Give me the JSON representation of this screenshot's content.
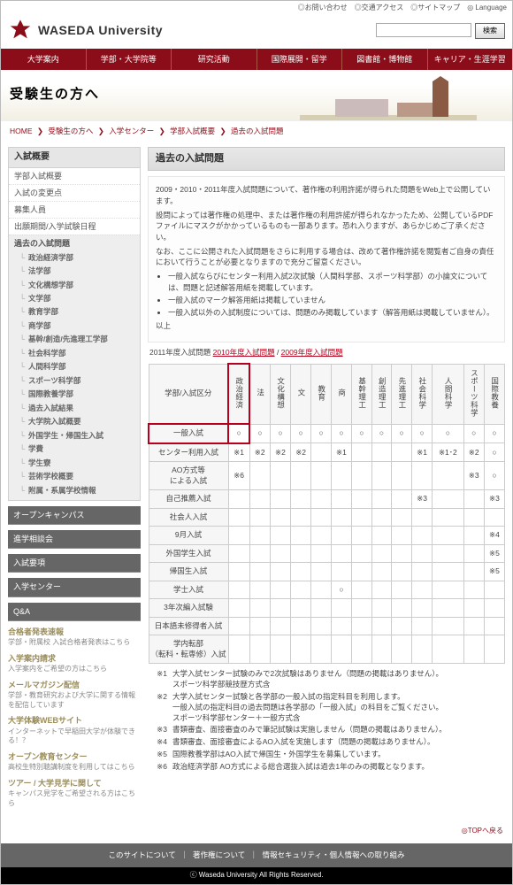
{
  "header": {
    "top_links": [
      "◎お問い合わせ",
      "◎交通アクセス",
      "◎サイトマップ",
      "◎ Language"
    ],
    "site_name": "WASEDA University",
    "search_button": "検索",
    "nav": [
      "大学案内",
      "学部・大学院等",
      "研究活動",
      "国際展開・留学",
      "図書館・博物館",
      "キャリア・生涯学習"
    ],
    "hero_title": "受験生の方へ"
  },
  "breadcrumb": {
    "items": [
      "HOME",
      "受験生の方へ",
      "入学センター",
      "学部入試概要",
      "過去の入試問題"
    ],
    "sep": "❯"
  },
  "side": {
    "title": "入試概要",
    "items": [
      {
        "label": "学部入試概要"
      },
      {
        "label": "入試の変更点"
      },
      {
        "label": "募集人員"
      },
      {
        "label": "出願期間/入学試験日程"
      },
      {
        "label": "過去の入試問題",
        "selected": true,
        "children": [
          "政治経済学部",
          "法学部",
          "文化構想学部",
          "文学部",
          "教育学部",
          "商学部",
          "基幹/創造/先進理工学部",
          "社会科学部",
          "人間科学部",
          "スポーツ科学部",
          "国際教養学部",
          "過去入試結果",
          "大学院入試概要",
          "外国学生・帰国生入試",
          "学費",
          "学生寮",
          "芸術学校概要",
          "附属・系属学校情報"
        ]
      }
    ],
    "dark_items": [
      "オープンキャンパス",
      "進学相談会",
      "入試要項",
      "入学センター",
      "Q&A"
    ],
    "link_items": [
      {
        "title": "合格者発表速報",
        "sub": "学部・附属校 入試合格者発表はこちら"
      },
      {
        "title": "入学案内請求",
        "sub": "入学案内をご希望の方はこちら"
      },
      {
        "title": "メールマガジン配信",
        "sub": "学部・教育研究および大学に関する情報を配信しています"
      },
      {
        "title": "大学体験WEBサイト",
        "sub": "インターネットで早稲田大学が体験できる！？"
      },
      {
        "title": "オープン教育センター",
        "sub": "高校生特別聴講制度を利用してはこちら"
      },
      {
        "title": "ツアー / 大学見学に関して",
        "sub": "キャンパス見学をご希望される方はこちら"
      }
    ]
  },
  "content": {
    "title": "過去の入試問題",
    "intro": [
      "2009・2010・2011年度入試問題について、著作権の利用許諾が得られた問題をWeb上で公開しています。",
      "設問によっては著作権の処理中、または著作権の利用許諾が得られなかったため、公開しているPDFファイルにマスクがかかっているものも一部あります。恐れ入りますが、あらかじめご了承ください。",
      "なお、ここに公開された入試問題をさらに利用する場合は、改めて著作権許諾を閲覧者ご自身の責任において行うことが必要となりますので充分ご留意ください。"
    ],
    "bullets": [
      "一般入試ならびにセンター利用入試2次試験（人間科学部、スポーツ科学部）の小論文については、問題と記述解答用紙を掲載しています。",
      "一般入試のマーク解答用紙は掲載していません",
      "一般入試以外の入試制度については、問題のみ掲載しています（解答用紙は掲載していません）。"
    ],
    "bullets_after": "以上",
    "years": {
      "pre": "2011年度入試問題",
      "active": "2010年度入試問題",
      "post": "2009年度入試問題"
    },
    "table": {
      "corner": "学部/入試区分",
      "cols": [
        "政治経済",
        "法",
        "文化構想",
        "文",
        "教育",
        "商",
        "基幹理工",
        "創造理工",
        "先進理工",
        "社会科学",
        "人間科学",
        "スポーツ科学",
        "国際教養"
      ],
      "rows": [
        {
          "h": "一般入試",
          "c": [
            "○",
            "○",
            "○",
            "○",
            "○",
            "○",
            "○",
            "○",
            "○",
            "○",
            "○",
            "○",
            "○"
          ],
          "hl": true
        },
        {
          "h": "センター利用入試",
          "c": [
            "※1",
            "※2",
            "※2",
            "※2",
            "",
            "※1",
            "",
            "",
            "",
            "※1",
            "※1･2",
            "※2",
            "○"
          ]
        },
        {
          "h": "AO方式等\nによる入試",
          "c": [
            "※6",
            "",
            "",
            "",
            "",
            "",
            "",
            "",
            "",
            "",
            "",
            "※3",
            "○"
          ]
        },
        {
          "h": "自己推薦入試",
          "c": [
            "",
            "",
            "",
            "",
            "",
            "",
            "",
            "",
            "",
            "※3",
            "",
            "",
            "※3"
          ]
        },
        {
          "h": "社会人入試",
          "c": [
            "",
            "",
            "",
            "",
            "",
            "",
            "",
            "",
            "",
            "",
            "",
            "",
            ""
          ]
        },
        {
          "h": "9月入試",
          "c": [
            "",
            "",
            "",
            "",
            "",
            "",
            "",
            "",
            "",
            "",
            "",
            "",
            "※4"
          ]
        },
        {
          "h": "外国学生入試",
          "c": [
            "",
            "",
            "",
            "",
            "",
            "",
            "",
            "",
            "",
            "",
            "",
            "",
            "※5"
          ]
        },
        {
          "h": "帰国生入試",
          "c": [
            "",
            "",
            "",
            "",
            "",
            "",
            "",
            "",
            "",
            "",
            "",
            "",
            "※5"
          ]
        },
        {
          "h": "学士入試",
          "c": [
            "",
            "",
            "",
            "",
            "",
            "○",
            "",
            "",
            "",
            "",
            "",
            "",
            ""
          ]
        },
        {
          "h": "3年次編入試験",
          "c": [
            "",
            "",
            "",
            "",
            "",
            "",
            "",
            "",
            "",
            "",
            "",
            "",
            ""
          ]
        },
        {
          "h": "日本語未修得者入試",
          "c": [
            "",
            "",
            "",
            "",
            "",
            "",
            "",
            "",
            "",
            "",
            "",
            "",
            ""
          ]
        },
        {
          "h": "学内転部\n（転科・転専修）入試",
          "c": [
            "",
            "",
            "",
            "",
            "",
            "",
            "",
            "",
            "",
            "",
            "",
            "",
            ""
          ]
        }
      ]
    },
    "notes": [
      {
        "k": "※1",
        "v": "大学入試センター試験のみで2次試験はありません（問題の掲載はありません）。\nスポーツ科学部競技歴方式含"
      },
      {
        "k": "※2",
        "v": "大学入試センター試験と各学部の一般入試の指定科目を利用します。\n一般入試の指定科目の過去問題は各学部の「一般入試」の科目をご覧ください。\nスポーツ科学部センター＋一般方式含"
      },
      {
        "k": "※3",
        "v": "書類審査、面接審査のみで筆記試験は実施しません（問題の掲載はありません）。"
      },
      {
        "k": "※4",
        "v": "書類審査、面接審査によるAO入試を実施します（問題の掲載はありません）。"
      },
      {
        "k": "※5",
        "v": "国際教養学部はAO入試で帰国生・外国学生を募集しています。"
      },
      {
        "k": "※6",
        "v": "政治経済学部 AO方式による総合選抜入試は過去1年のみの掲載となります。"
      }
    ],
    "top_link": "◎TOPへ戻る"
  },
  "footer": {
    "links": [
      "このサイトについて",
      "著作権について",
      "情報セキュリティ・個人情報への取り組み"
    ],
    "sep": "｜",
    "copy": "ⓒ Waseda University All Rights Reserved."
  }
}
